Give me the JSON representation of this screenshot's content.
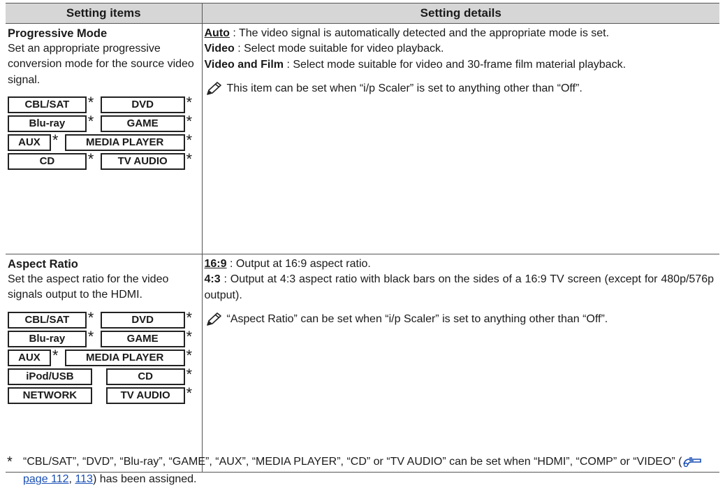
{
  "headers": {
    "col1": "Setting items",
    "col2": "Setting details"
  },
  "rows": [
    {
      "title": "Progressive Mode",
      "desc": "Set an appropriate progressive conversion mode for the source video signal.",
      "sources": [
        [
          {
            "label": "CBL/SAT",
            "star": "*"
          },
          {
            "label": "DVD",
            "star": "*"
          }
        ],
        [
          {
            "label": "Blu-ray",
            "star": "*"
          },
          {
            "label": "GAME",
            "star": "*"
          }
        ],
        [
          {
            "label": "AUX",
            "star": "*"
          },
          {
            "label": "MEDIA PLAYER",
            "star": "*"
          }
        ],
        [
          {
            "label": "CD",
            "star": "*"
          },
          {
            "label": "TV AUDIO",
            "star": "*"
          }
        ]
      ],
      "options": [
        {
          "name": "Auto",
          "text": " : The video signal is automatically detected and the appropriate mode is set."
        },
        {
          "name": "Video",
          "text": " : Select mode suitable for video playback."
        },
        {
          "name": "Video and Film",
          "text": " : Select mode suitable for video and 30-frame film material playback."
        }
      ],
      "note": "This item can be set when “i/p Scaler” is set to anything other than “Off”."
    },
    {
      "title": "Aspect Ratio",
      "desc": "Set the aspect ratio for the video signals output to the HDMI.",
      "sources": [
        [
          {
            "label": "CBL/SAT",
            "star": "*"
          },
          {
            "label": "DVD",
            "star": "*"
          }
        ],
        [
          {
            "label": "Blu-ray",
            "star": "*"
          },
          {
            "label": "GAME",
            "star": "*"
          }
        ],
        [
          {
            "label": "AUX",
            "star": "*"
          },
          {
            "label": "MEDIA PLAYER",
            "star": "*"
          }
        ],
        [
          {
            "label": "iPod/USB",
            "star": ""
          },
          {
            "label": "CD",
            "star": "*"
          }
        ],
        [
          {
            "label": "NETWORK",
            "star": ""
          },
          {
            "label": "TV AUDIO",
            "star": "*"
          }
        ]
      ],
      "options": [
        {
          "name": "16:9",
          "text": " : Output at 16:9 aspect ratio."
        },
        {
          "name": "4:3",
          "text": " : Output at 4:3 aspect ratio with black bars on the sides of a 16:9 TV screen (except for 480p/576p output)."
        }
      ],
      "note": "“Aspect Ratio” can be set when “i/p Scaler” is set to anything other than “Off”."
    }
  ],
  "footnote": {
    "star": "*",
    "text_before": "“CBL/SAT”, “DVD”, “Blu-ray”, “GAME”, “AUX”, “MEDIA PLAYER”, “CD” or “TV AUDIO” can be set when “HDMI”, “COMP” or “VIDEO” (",
    "link1": "page 112",
    "sep": ", ",
    "link2": "113",
    "text_after": ") has been assigned."
  }
}
